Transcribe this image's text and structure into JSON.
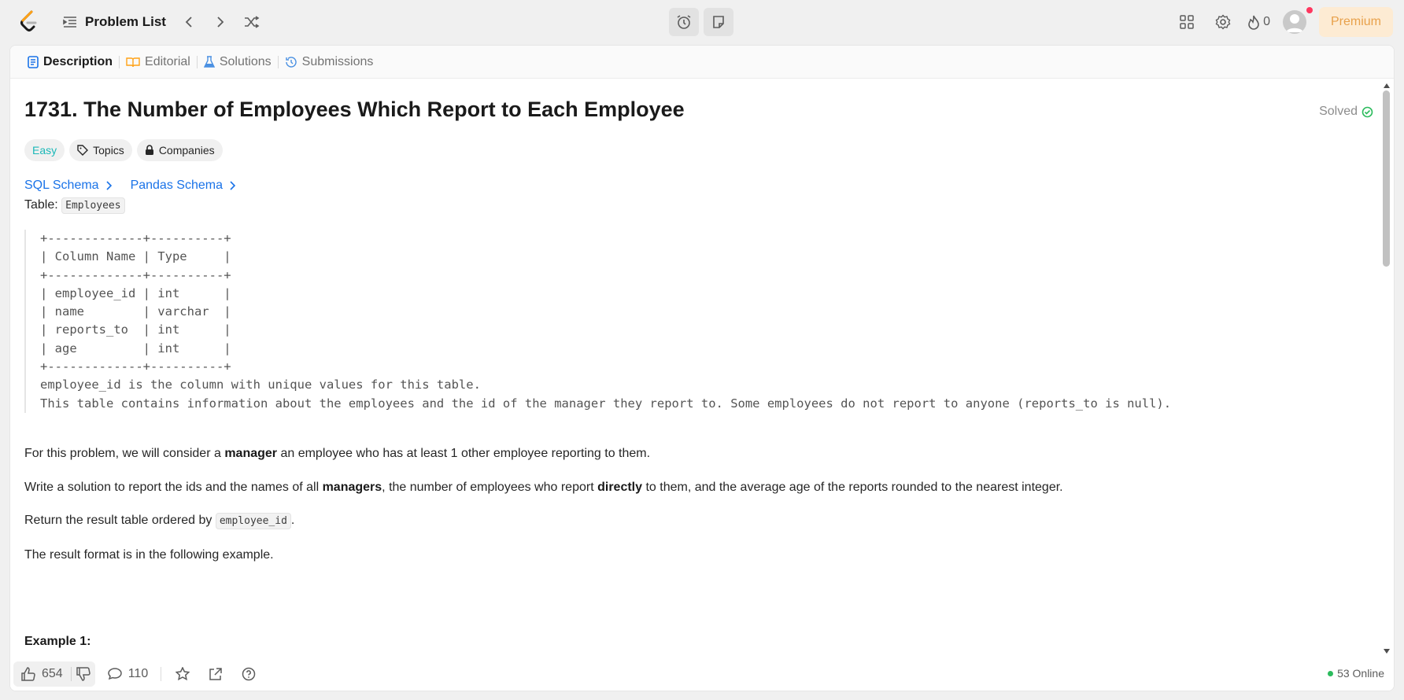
{
  "nav": {
    "problem_list_label": "Problem List",
    "streak_count": "0",
    "premium_label": "Premium"
  },
  "tabs": [
    {
      "label": "Description"
    },
    {
      "label": "Editorial"
    },
    {
      "label": "Solutions"
    },
    {
      "label": "Submissions"
    }
  ],
  "problem": {
    "title": "1731. The Number of Employees Which Report to Each Employee",
    "status": "Solved",
    "difficulty": "Easy",
    "topics_label": "Topics",
    "companies_label": "Companies",
    "sql_schema_label": "SQL Schema",
    "pandas_schema_label": "Pandas Schema",
    "table_prefix": "Table: ",
    "table_name": "Employees",
    "schema_block": "+-------------+----------+\n| Column Name | Type     |\n+-------------+----------+\n| employee_id | int      |\n| name        | varchar  |\n| reports_to  | int      |\n| age         | int      |\n+-------------+----------+\nemployee_id is the column with unique values for this table.\nThis table contains information about the employees and the id of the manager they report to. Some employees do not report to anyone (reports_to is null).",
    "p1_a": "For this problem, we will consider a ",
    "p1_b": "manager",
    "p1_c": " an employee who has at least 1 other employee reporting to them.",
    "p2_a": "Write a solution to report the ids and the names of all ",
    "p2_b": "managers",
    "p2_c": ", the number of employees who report ",
    "p2_d": "directly",
    "p2_e": " to them, and the average age of the reports rounded to the nearest integer.",
    "p3_a": "Return the result table ordered by ",
    "p3_code": "employee_id",
    "p3_c": ".",
    "p4": "The result format is in the following example.",
    "example_label": "Example 1:"
  },
  "footer": {
    "likes": "654",
    "comments": "110",
    "online": "53 Online"
  },
  "colors": {
    "accent_link": "#1a73e8",
    "easy": "#1cb8b8",
    "solved_check": "#2cbb5d",
    "premium_text": "#e8a14b",
    "premium_bg": "#fdebd3"
  }
}
